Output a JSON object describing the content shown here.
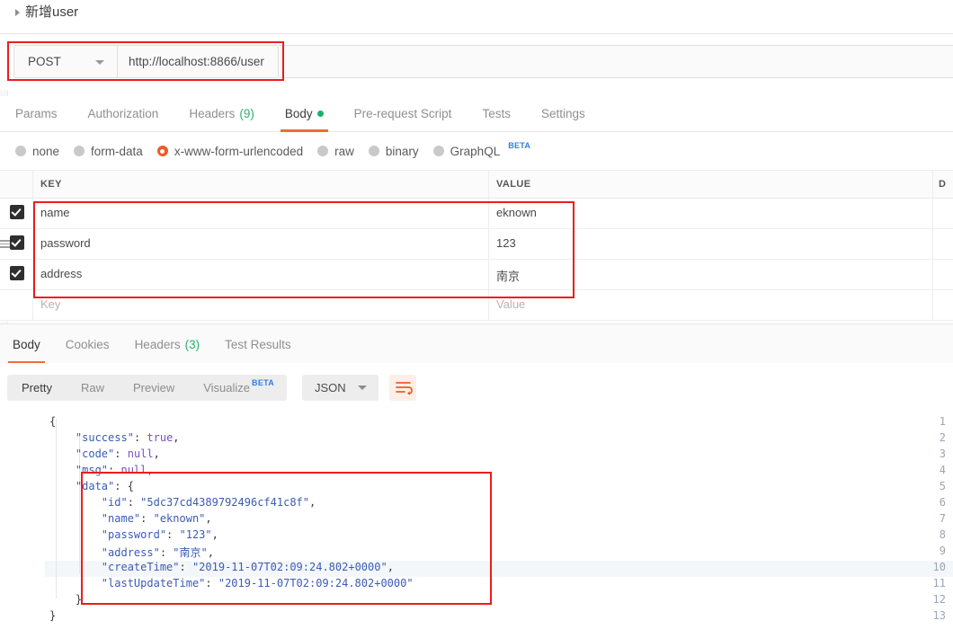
{
  "window": {
    "title": "新增user",
    "collapse_icon": "triangle-right-icon"
  },
  "request": {
    "method": "POST",
    "method_caret_icon": "chevron-down-icon",
    "url": "http://localhost:8866/user",
    "tabs": [
      {
        "label": "Params",
        "active": false,
        "count": null,
        "dot": false
      },
      {
        "label": "Authorization",
        "active": false,
        "count": null,
        "dot": false
      },
      {
        "label": "Headers",
        "active": false,
        "count": "(9)",
        "dot": false
      },
      {
        "label": "Body",
        "active": true,
        "count": null,
        "dot": true
      },
      {
        "label": "Pre-request Script",
        "active": false,
        "count": null,
        "dot": false
      },
      {
        "label": "Tests",
        "active": false,
        "count": null,
        "dot": false
      },
      {
        "label": "Settings",
        "active": false,
        "count": null,
        "dot": false
      }
    ],
    "body_types": [
      {
        "label": "none",
        "selected": false,
        "badge": null
      },
      {
        "label": "form-data",
        "selected": false,
        "badge": null
      },
      {
        "label": "x-www-form-urlencoded",
        "selected": true,
        "badge": null
      },
      {
        "label": "raw",
        "selected": false,
        "badge": null
      },
      {
        "label": "binary",
        "selected": false,
        "badge": null
      },
      {
        "label": "GraphQL",
        "selected": false,
        "badge": "BETA"
      }
    ]
  },
  "params_table": {
    "headers": {
      "key": "KEY",
      "value": "VALUE",
      "description": "D"
    },
    "rows": [
      {
        "checked": true,
        "key": "name",
        "value": "eknown",
        "drag": false
      },
      {
        "checked": true,
        "key": "password",
        "value": "123",
        "drag": true
      },
      {
        "checked": true,
        "key": "address",
        "value": "南京",
        "drag": false
      }
    ],
    "placeholder_row": {
      "key": "Key",
      "value": "Value"
    }
  },
  "response": {
    "tabs": [
      {
        "label": "Body",
        "active": true,
        "count": null
      },
      {
        "label": "Cookies",
        "active": false,
        "count": null
      },
      {
        "label": "Headers",
        "active": false,
        "count": "(3)"
      },
      {
        "label": "Test Results",
        "active": false,
        "count": null
      }
    ],
    "view_modes": [
      {
        "label": "Pretty",
        "active": true,
        "badge": null
      },
      {
        "label": "Raw",
        "active": false,
        "badge": null
      },
      {
        "label": "Preview",
        "active": false,
        "badge": null
      },
      {
        "label": "Visualize",
        "active": false,
        "badge": "BETA"
      }
    ],
    "format": "JSON",
    "format_caret_icon": "chevron-down-icon",
    "wrap_icon": "wrap-text-icon",
    "code_lines": [
      {
        "n": "1",
        "text": "{"
      },
      {
        "n": "2",
        "text": "    \"success\": true,"
      },
      {
        "n": "3",
        "text": "    \"code\": null,"
      },
      {
        "n": "4",
        "text": "    \"msg\": null,"
      },
      {
        "n": "5",
        "text": "    \"data\": {"
      },
      {
        "n": "6",
        "text": "        \"id\": \"5dc37cd4389792496cf41c8f\","
      },
      {
        "n": "7",
        "text": "        \"name\": \"eknown\","
      },
      {
        "n": "8",
        "text": "        \"password\": \"123\","
      },
      {
        "n": "9",
        "text": "        \"address\": \"南京\","
      },
      {
        "n": "10",
        "text": "        \"createTime\": \"2019-11-07T02:09:24.802+0000\","
      },
      {
        "n": "11",
        "text": "        \"lastUpdateTime\": \"2019-11-07T02:09:24.802+0000\""
      },
      {
        "n": "12",
        "text": "    }"
      },
      {
        "n": "13",
        "text": "}"
      }
    ]
  },
  "annotations": {
    "color": "#ee1c1c",
    "boxes": [
      "url-bar-highlight",
      "params-table-highlight",
      "json-data-highlight"
    ]
  },
  "colors": {
    "accent": "#ef6c37",
    "radio_selected": "#f05a28",
    "count_green": "#28b16d",
    "beta_blue": "#2f7fe0",
    "annotation_red": "#ee1c1c"
  }
}
